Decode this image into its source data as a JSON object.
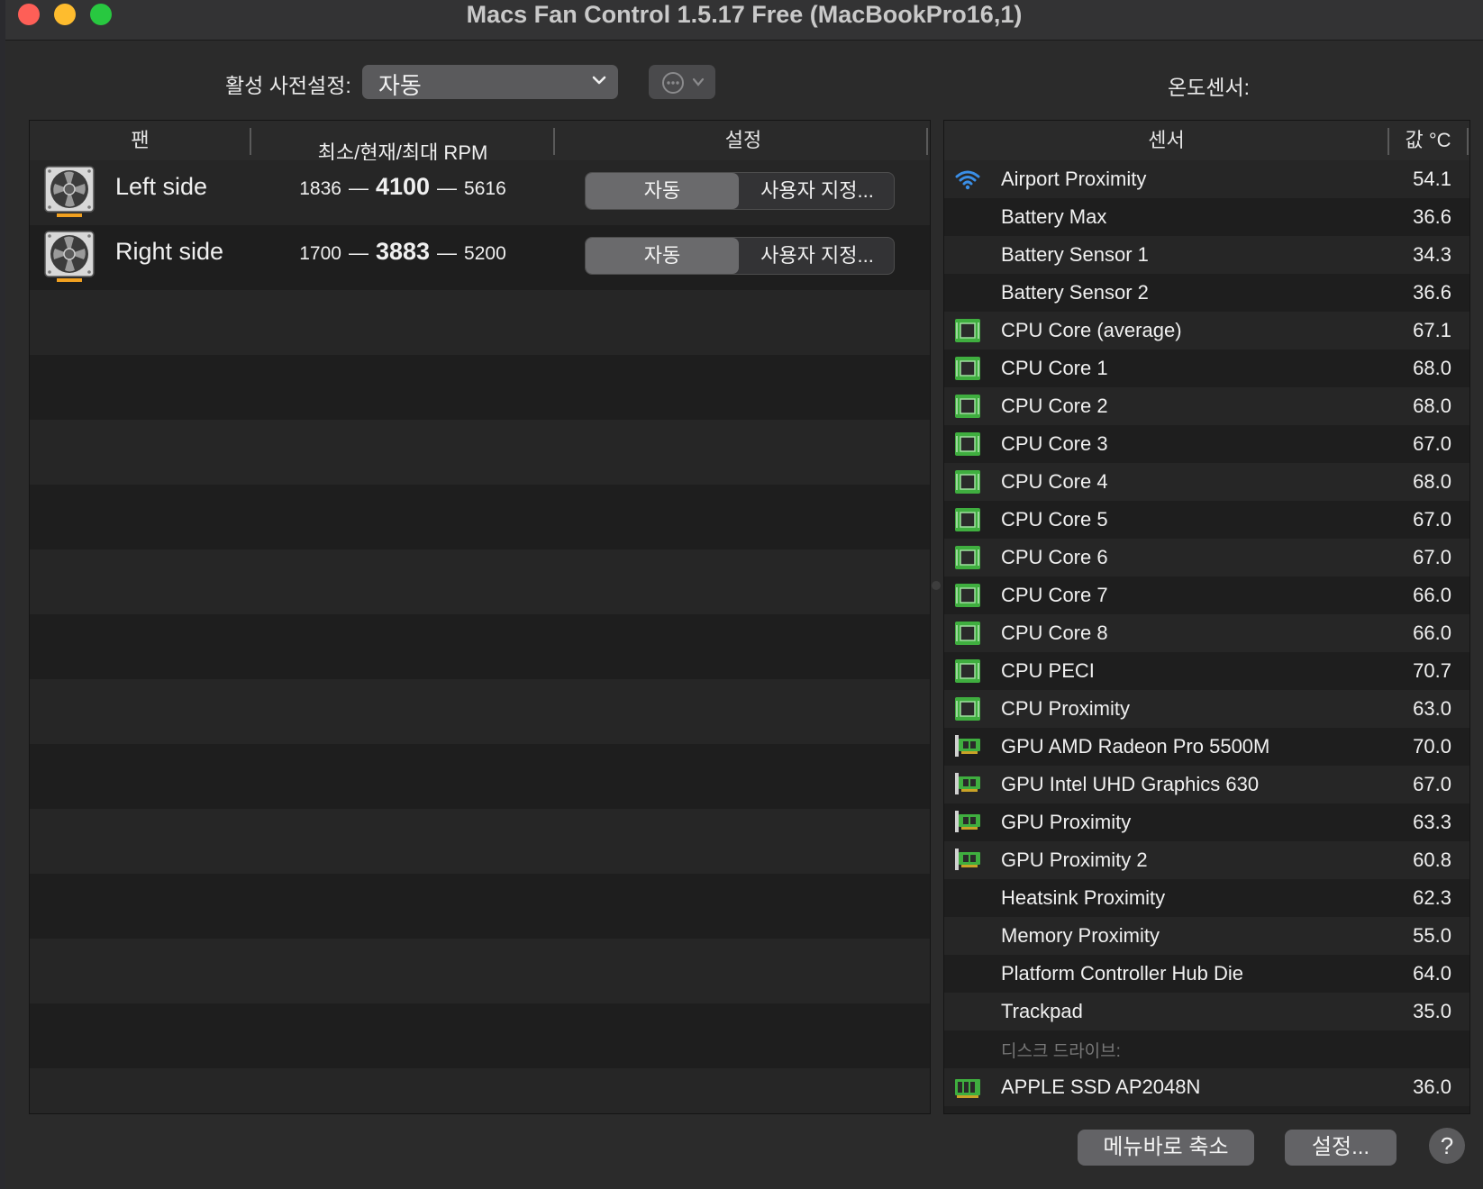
{
  "window": {
    "title": "Macs Fan Control 1.5.17 Free (MacBookPro16,1)"
  },
  "toolbar": {
    "preset_label": "활성 사전설정:",
    "preset_value": "자동",
    "sensors_label": "온도센서:"
  },
  "fan_table": {
    "headers": {
      "fan": "팬",
      "rpm": "최소/현재/최대 RPM",
      "settings": "설정"
    },
    "fans": [
      {
        "name": "Left side",
        "min": "1836",
        "current": "4100",
        "max": "5616",
        "auto_label": "자동",
        "custom_label": "사용자 지정..."
      },
      {
        "name": "Right side",
        "min": "1700",
        "current": "3883",
        "max": "5200",
        "auto_label": "자동",
        "custom_label": "사용자 지정..."
      }
    ],
    "dash": "—"
  },
  "sensor_table": {
    "headers": {
      "sensor": "센서",
      "value": "값 °C"
    },
    "sensors": [
      {
        "icon": "wifi-icon",
        "name": "Airport Proximity",
        "value": "54.1"
      },
      {
        "icon": "none",
        "name": "Battery Max",
        "value": "36.6"
      },
      {
        "icon": "none",
        "name": "Battery Sensor 1",
        "value": "34.3"
      },
      {
        "icon": "none",
        "name": "Battery Sensor 2",
        "value": "36.6"
      },
      {
        "icon": "cpu-chip-icon",
        "name": "CPU Core (average)",
        "value": "67.1"
      },
      {
        "icon": "cpu-chip-icon",
        "name": "CPU Core 1",
        "value": "68.0"
      },
      {
        "icon": "cpu-chip-icon",
        "name": "CPU Core 2",
        "value": "68.0"
      },
      {
        "icon": "cpu-chip-icon",
        "name": "CPU Core 3",
        "value": "67.0"
      },
      {
        "icon": "cpu-chip-icon",
        "name": "CPU Core 4",
        "value": "68.0"
      },
      {
        "icon": "cpu-chip-icon",
        "name": "CPU Core 5",
        "value": "67.0"
      },
      {
        "icon": "cpu-chip-icon",
        "name": "CPU Core 6",
        "value": "67.0"
      },
      {
        "icon": "cpu-chip-icon",
        "name": "CPU Core 7",
        "value": "66.0"
      },
      {
        "icon": "cpu-chip-icon",
        "name": "CPU Core 8",
        "value": "66.0"
      },
      {
        "icon": "cpu-chip-icon",
        "name": "CPU PECI",
        "value": "70.7"
      },
      {
        "icon": "cpu-chip-icon",
        "name": "CPU Proximity",
        "value": "63.0"
      },
      {
        "icon": "gpu-card-icon",
        "name": "GPU AMD Radeon Pro 5500M",
        "value": "70.0"
      },
      {
        "icon": "gpu-card-icon",
        "name": "GPU Intel UHD Graphics 630",
        "value": "67.0"
      },
      {
        "icon": "gpu-card-icon",
        "name": "GPU Proximity",
        "value": "63.3"
      },
      {
        "icon": "gpu-card-icon",
        "name": "GPU Proximity 2",
        "value": "60.8"
      },
      {
        "icon": "none",
        "name": "Heatsink Proximity",
        "value": "62.3"
      },
      {
        "icon": "none",
        "name": "Memory Proximity",
        "value": "55.0"
      },
      {
        "icon": "none",
        "name": "Platform Controller Hub Die",
        "value": "64.0"
      },
      {
        "icon": "none",
        "name": "Trackpad",
        "value": "35.0"
      }
    ],
    "disk_group_label": "디스크 드라이브:",
    "disks": [
      {
        "icon": "ssd-icon",
        "name": "APPLE SSD AP2048N",
        "value": "36.0"
      }
    ]
  },
  "footer": {
    "minimize_label": "메뉴바로 축소",
    "settings_label": "설정...",
    "help_label": "?"
  },
  "colors": {
    "close": "#fe5f57",
    "minimize": "#febc2e",
    "maximize": "#28c840",
    "wifi": "#3a8ee6",
    "chip_green": "#3fae3f",
    "fan_accent": "#f0a020"
  }
}
